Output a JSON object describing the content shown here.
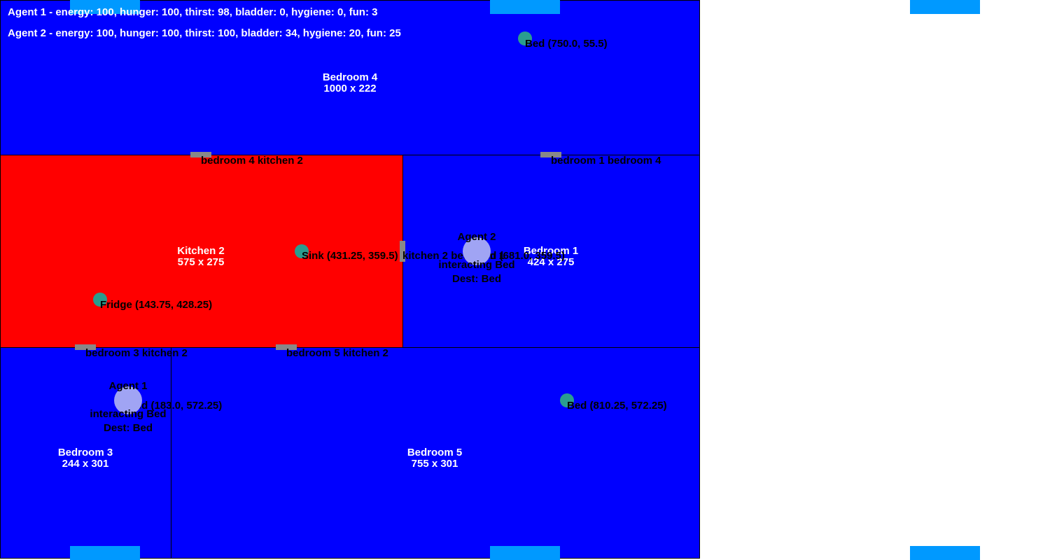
{
  "colors": {
    "bedroom": "#0000ff",
    "kitchen": "#ff0000",
    "door": "#888888",
    "tab": "#0099ff",
    "object": "#2a9d8f",
    "agent": "#a0a4f4"
  },
  "stats": {
    "agent1": "Agent 1 - energy: 100, hunger: 100, thirst: 98, bladder: 0, hygiene: 0, fun: 3",
    "agent2": "Agent 2 - energy: 100, hunger: 100, thirst: 100, bladder: 34, hygiene: 20, fun: 25"
  },
  "rooms": [
    {
      "id": "bedroom-4",
      "kind": "bedroom",
      "name": "Bedroom 4",
      "size": "1000 x 222"
    },
    {
      "id": "kitchen-2",
      "kind": "kitchen",
      "name": "Kitchen 2",
      "size": "575 x 275"
    },
    {
      "id": "bedroom-1",
      "kind": "bedroom",
      "name": "Bedroom 1",
      "size": "424 x 275"
    },
    {
      "id": "bedroom-3",
      "kind": "bedroom",
      "name": "Bedroom 3",
      "size": "244 x 301"
    },
    {
      "id": "bedroom-5",
      "kind": "bedroom",
      "name": "Bedroom 5",
      "size": "755 x 301"
    }
  ],
  "doors": [
    {
      "id": "bedroom-4-kitchen-2",
      "label": "bedroom 4 kitchen 2"
    },
    {
      "id": "bedroom-1-bedroom-4",
      "label": "bedroom 1 bedroom 4"
    },
    {
      "id": "kitchen-2-bedroom-1",
      "label": "kitchen 2 bedroom 1"
    },
    {
      "id": "bedroom-3-kitchen-2",
      "label": "bedroom 3 kitchen 2"
    },
    {
      "id": "bedroom-5-kitchen-2",
      "label": "bedroom 5 kitchen 2"
    }
  ],
  "objects": [
    {
      "id": "bed-bedroom-4",
      "label": "Bed (750.0, 55.5)"
    },
    {
      "id": "sink-kitchen-2",
      "label": "Sink (431.25, 359.5)"
    },
    {
      "id": "fridge-kitchen-2",
      "label": "Fridge (143.75, 428.25)"
    },
    {
      "id": "bed-bedroom-1",
      "label": "Bed (681.0, 359.5)"
    },
    {
      "id": "bed-bedroom-5",
      "label": "Bed (810.25, 572.25)"
    },
    {
      "id": "bed-bedroom-3",
      "label": "Bed (183.0, 572.25)"
    }
  ],
  "agents": [
    {
      "id": "agent-1",
      "name": "Agent 1",
      "status": "interacting Bed",
      "dest": "Dest: Bed"
    },
    {
      "id": "agent-2",
      "name": "Agent 2",
      "status": "interacting Bed",
      "dest": "Dest: Bed"
    }
  ]
}
